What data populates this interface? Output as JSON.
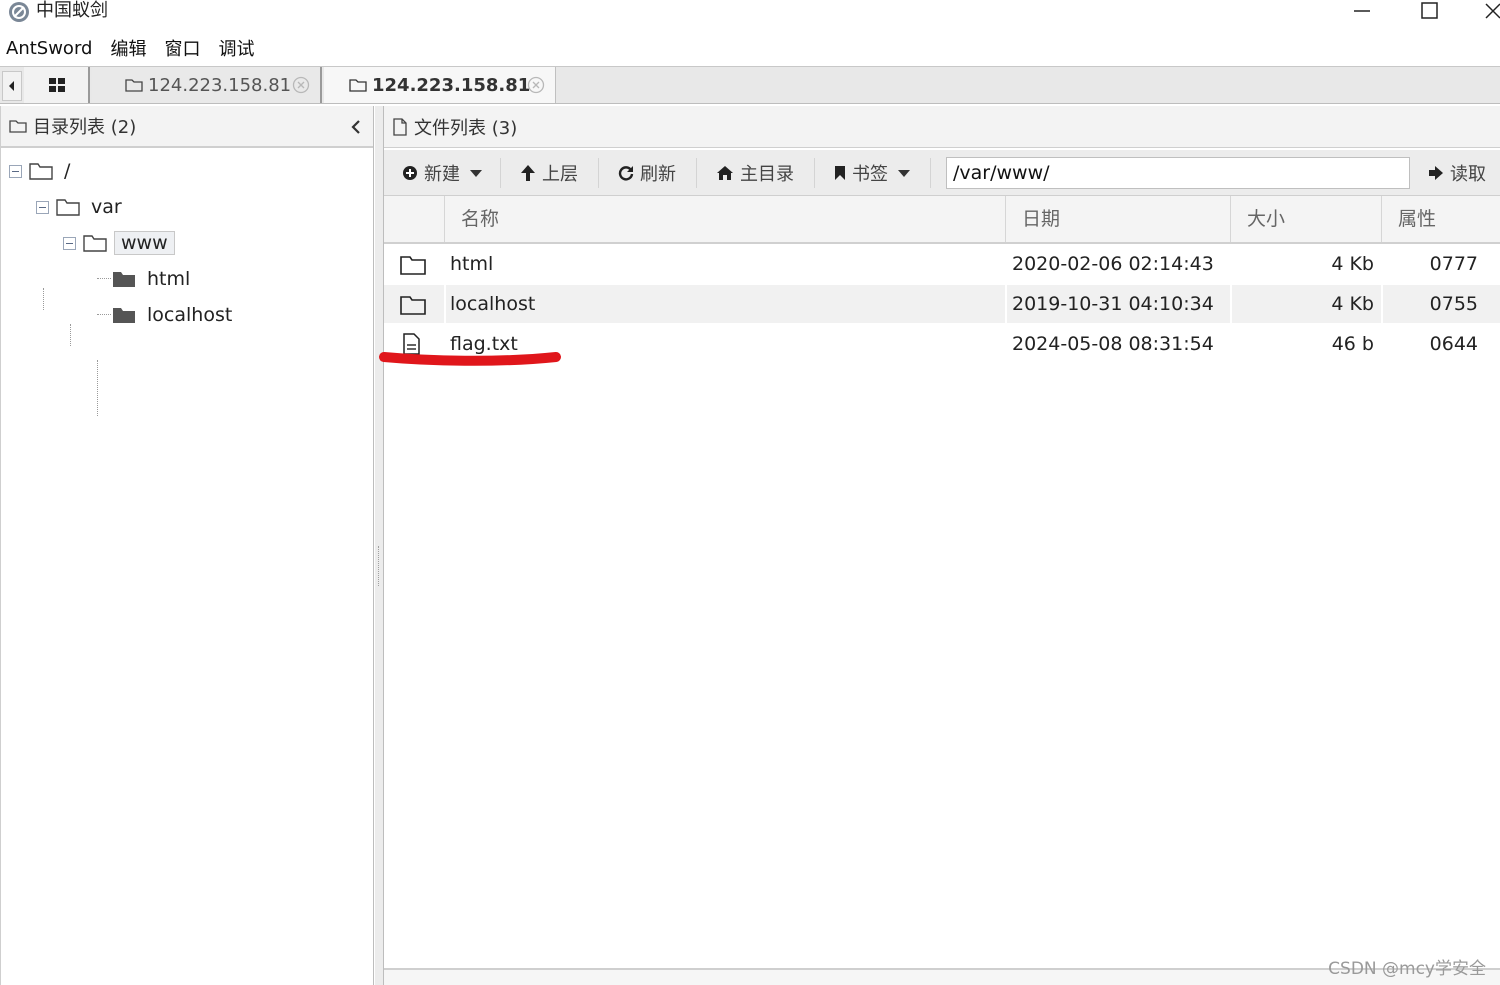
{
  "window": {
    "title": "中国蚁剑"
  },
  "menubar": {
    "items": [
      "AntSword",
      "编辑",
      "窗口",
      "调试"
    ]
  },
  "tabs": [
    {
      "label": "124.223.158.81",
      "active": false
    },
    {
      "label": "124.223.158.81",
      "active": true
    }
  ],
  "dir_panel": {
    "title": "目录列表 (2)",
    "tree": [
      {
        "label": "/",
        "depth": 0,
        "expanded": true
      },
      {
        "label": "var",
        "depth": 1,
        "expanded": true
      },
      {
        "label": "www",
        "depth": 2,
        "expanded": true,
        "selected": true
      },
      {
        "label": "html",
        "depth": 3
      },
      {
        "label": "localhost",
        "depth": 3
      }
    ]
  },
  "file_panel": {
    "title": "文件列表 (3)",
    "toolbar": {
      "new_label": "新建",
      "up_label": "上层",
      "refresh_label": "刷新",
      "home_label": "主目录",
      "bookmark_label": "书签",
      "path_value": "/var/www/",
      "read_label": "读取"
    },
    "columns": [
      "名称",
      "日期",
      "大小",
      "属性"
    ],
    "rows": [
      {
        "type": "folder",
        "name": "html",
        "date": "2020-02-06 02:14:43",
        "size": "4 Kb",
        "attr": "0777"
      },
      {
        "type": "folder",
        "name": "localhost",
        "date": "2019-10-31 04:10:34",
        "size": "4 Kb",
        "attr": "0755"
      },
      {
        "type": "file",
        "name": "flag.txt",
        "date": "2024-05-08 08:31:54",
        "size": "46 b",
        "attr": "0644"
      }
    ]
  },
  "annotation": {
    "color": "#e0161b"
  },
  "watermark": "CSDN @mcy学安全"
}
